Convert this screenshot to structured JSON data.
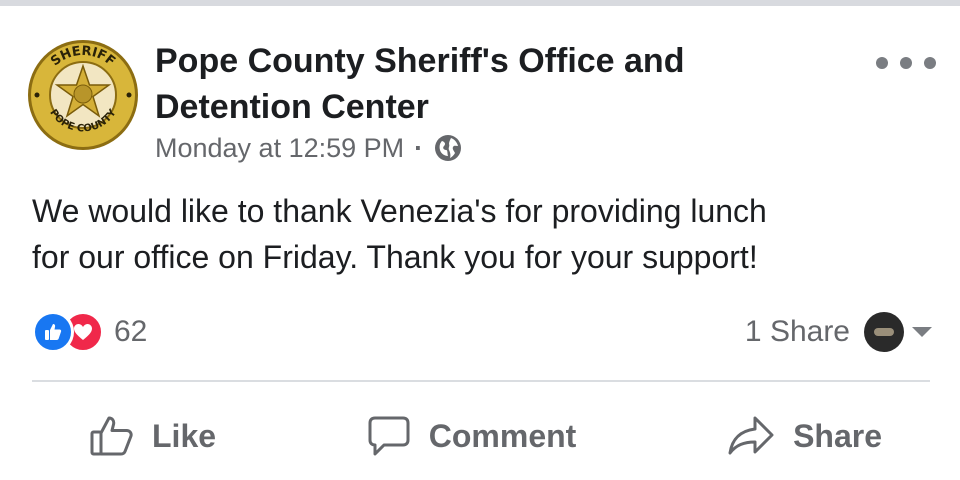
{
  "post": {
    "author_name_line1": "Pope County Sheriff's Office and",
    "author_name_line2": "Detention Center",
    "timestamp": "Monday at 12:59 PM",
    "separator": "·",
    "privacy_icon": "globe-icon",
    "badge": {
      "top_text": "SHERIFF",
      "bottom_text": "POPE COUNTY"
    },
    "body_line1": "We would like to thank Venezia's for providing lunch",
    "body_line2": "for our office on Friday. Thank you for your support!"
  },
  "stats": {
    "reaction_icons": [
      "like-icon",
      "love-icon"
    ],
    "reaction_count": "62",
    "share_count": "1 Share"
  },
  "actions": {
    "like_label": "Like",
    "comment_label": "Comment",
    "share_label": "Share"
  },
  "colors": {
    "like_blue": "#1877f2",
    "love_red": "#f0284a",
    "badge_gold": "#c9a227",
    "secondary_text": "#65676b"
  }
}
